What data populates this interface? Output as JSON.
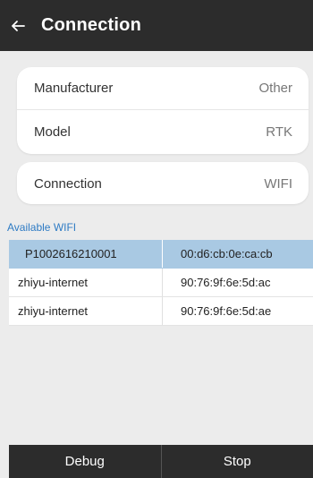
{
  "header": {
    "title": "Connection",
    "back_icon": "arrow-left-icon"
  },
  "device": {
    "manufacturer": {
      "label": "Manufacturer",
      "value": "Other"
    },
    "model": {
      "label": "Model",
      "value": "RTK"
    }
  },
  "connection": {
    "label": "Connection",
    "value": "WIFI"
  },
  "wifi": {
    "section_label": "Available WIFI",
    "rows": [
      {
        "ssid": "P1002616210001",
        "mac": "00:d6:cb:0e:ca:cb",
        "selected": true
      },
      {
        "ssid": "zhiyu-internet",
        "mac": "90:76:9f:6e:5d:ac",
        "selected": false
      },
      {
        "ssid": "zhiyu-internet",
        "mac": "90:76:9f:6e:5d:ae",
        "selected": false
      }
    ]
  },
  "footer": {
    "debug_label": "Debug",
    "stop_label": "Stop"
  },
  "colors": {
    "header_bg": "#2c2c2c",
    "accent": "#2e7bc4",
    "selected_row": "#a9c9e3"
  }
}
